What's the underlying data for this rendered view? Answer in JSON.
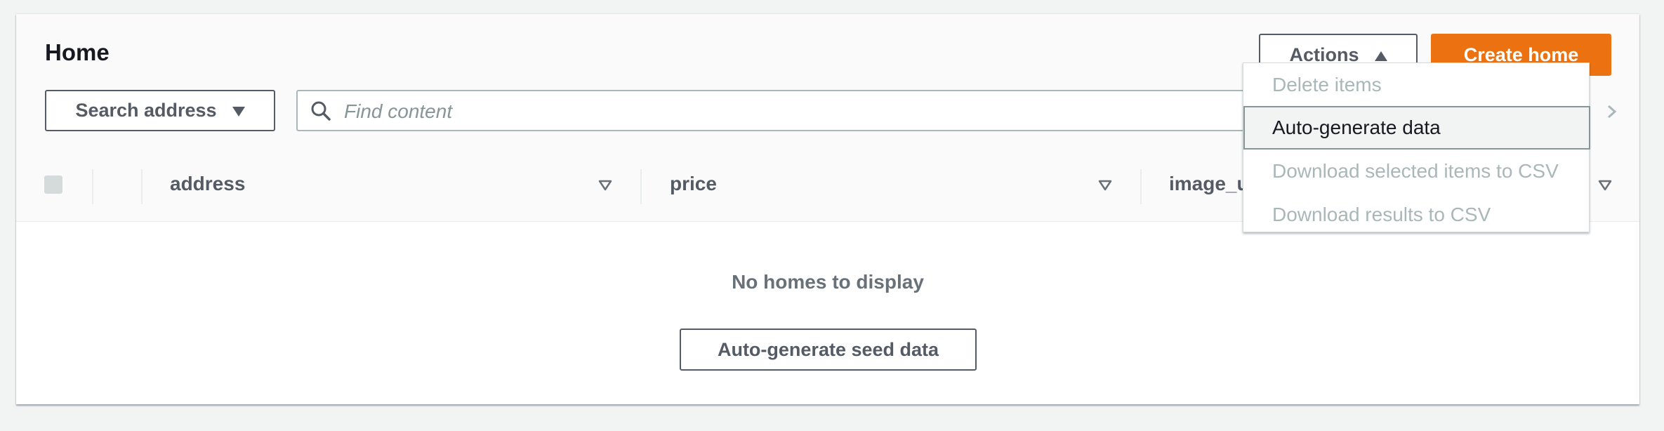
{
  "header": {
    "title": "Home",
    "actions_label": "Actions",
    "create_label": "Create home"
  },
  "filter": {
    "search_address_label": "Search address",
    "search_placeholder": "Find content"
  },
  "table": {
    "columns": [
      "address",
      "price",
      "image_url"
    ],
    "empty_message": "No homes to display",
    "seed_button_label": "Auto-generate seed data"
  },
  "actions_menu": {
    "items": [
      {
        "label": "Delete items",
        "disabled": true
      },
      {
        "label": "Auto-generate data",
        "disabled": false
      },
      {
        "label": "Download selected items to CSV",
        "disabled": true
      },
      {
        "label": "Download results to CSV",
        "disabled": true
      }
    ]
  },
  "colors": {
    "primary_button": "#ec7211",
    "border_dark": "#545b64",
    "disabled_text": "#aab7b8"
  },
  "icons": [
    "caret-up-icon",
    "caret-down-icon",
    "search-icon",
    "sort-icon",
    "chevron-right-icon"
  ]
}
